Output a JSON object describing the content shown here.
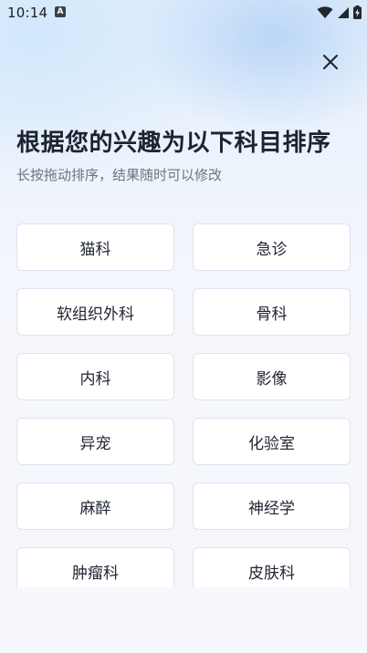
{
  "status_bar": {
    "time": "10:14",
    "app_badge": "A",
    "icons": [
      "wifi-icon",
      "cellular-signal-icon",
      "battery-charging-icon"
    ]
  },
  "header": {
    "title": "根据您的兴趣为以下科目排序",
    "subtitle": "长按拖动排序，结果随时可以修改",
    "close_icon": "close-icon"
  },
  "subjects": [
    {
      "label": "猫科"
    },
    {
      "label": "急诊"
    },
    {
      "label": "软组织外科"
    },
    {
      "label": "骨科"
    },
    {
      "label": "内科"
    },
    {
      "label": "影像"
    },
    {
      "label": "异宠"
    },
    {
      "label": "化验室"
    },
    {
      "label": "麻醉"
    },
    {
      "label": "神经学"
    },
    {
      "label": "肿瘤科"
    },
    {
      "label": "皮肤科"
    }
  ],
  "colors": {
    "background": "#f5f7fd",
    "card_background": "#ffffff",
    "card_border": "#dde3ef",
    "title_text": "#1e2330",
    "subtitle_text": "#6e7480"
  }
}
